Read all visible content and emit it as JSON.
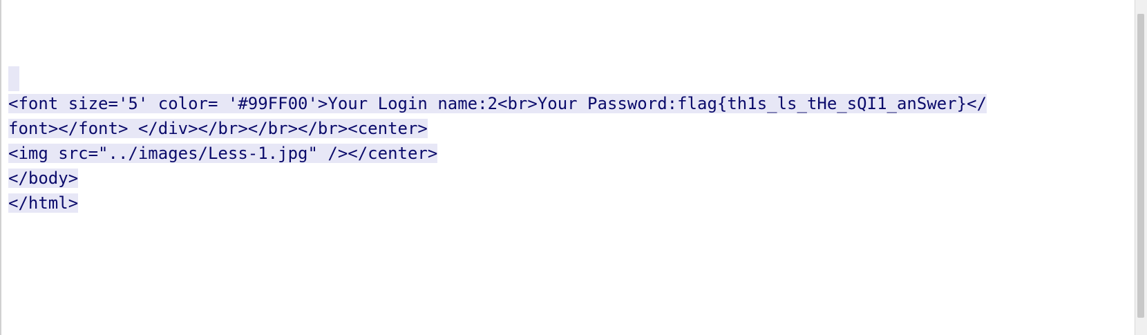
{
  "source_view": {
    "lines": [
      "",
      "<font size='5' color= '#99FF00'>Your Login name:2<br>Your Password:flag{th1s_ls_tHe_sQI1_anSwer}</",
      "font></font> </div></br></br></br><center>",
      "<img src=\"../images/Less-1.jpg\" /></center>",
      "</body>",
      "</html>"
    ],
    "colors": {
      "text": "#0a0a6a",
      "selection": "#e7e7f6",
      "background": "#ffffff"
    }
  }
}
